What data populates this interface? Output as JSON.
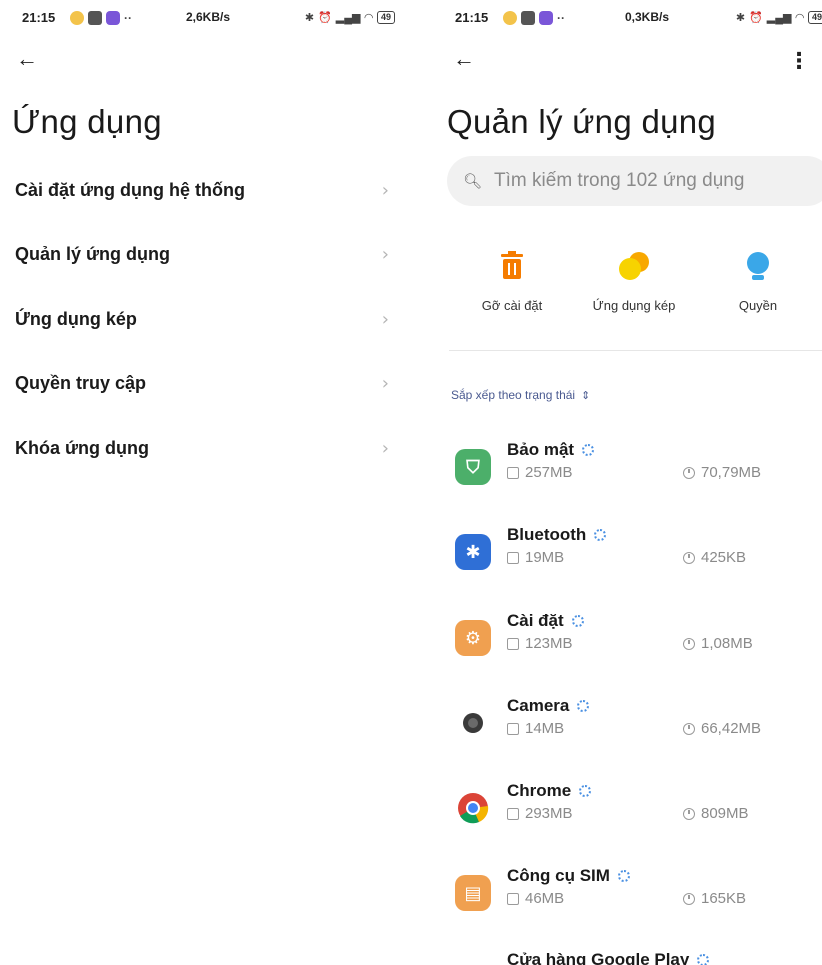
{
  "left": {
    "status": {
      "time": "21:15",
      "speed": "2,6KB/s",
      "battery": "49"
    },
    "title": "Ứng dụng",
    "items": [
      {
        "label": "Cài đặt ứng dụng hệ thống"
      },
      {
        "label": "Quản lý ứng dụng"
      },
      {
        "label": "Ứng dụng kép"
      },
      {
        "label": "Quyền truy cập"
      },
      {
        "label": "Khóa ứng dụng"
      }
    ]
  },
  "right": {
    "status": {
      "time": "21:15",
      "speed": "0,3KB/s",
      "battery": "49"
    },
    "title": "Quản lý ứng dụng",
    "search_placeholder": "Tìm kiếm trong 102 ứng dụng",
    "actions": [
      {
        "label": "Gỡ cài đặt",
        "icon": "trash-icon",
        "color": "#f57c00"
      },
      {
        "label": "Ứng dụng kép",
        "icon": "dual-apps-icon",
        "color": "#f4c400"
      },
      {
        "label": "Quyền",
        "icon": "permissions-icon",
        "color": "#3aa7e8"
      }
    ],
    "sort_label": "Sắp xếp theo trạng thái",
    "apps": [
      {
        "name": "Bảo mật",
        "size": "257MB",
        "cache": "70,79MB",
        "icon": "security-app-icon",
        "color": "#4caf6a"
      },
      {
        "name": "Bluetooth",
        "size": "19MB",
        "cache": "425KB",
        "icon": "bluetooth-app-icon",
        "color": "#2f6fd6"
      },
      {
        "name": "Cài đặt",
        "size": "123MB",
        "cache": "1,08MB",
        "icon": "settings-app-icon",
        "color": "#f0a050"
      },
      {
        "name": "Camera",
        "size": "14MB",
        "cache": "66,42MB",
        "icon": "camera-app-icon",
        "color": "#ffffff"
      },
      {
        "name": "Chrome",
        "size": "293MB",
        "cache": "809MB",
        "icon": "chrome-app-icon",
        "color": "#ffffff"
      },
      {
        "name": "Công cụ SIM",
        "size": "46MB",
        "cache": "165KB",
        "icon": "sim-toolkit-app-icon",
        "color": "#f0a050"
      },
      {
        "name": "Cửa hàng Google Play",
        "size": "",
        "cache": "",
        "icon": "play-store-app-icon",
        "color": "#ffffff"
      }
    ]
  }
}
